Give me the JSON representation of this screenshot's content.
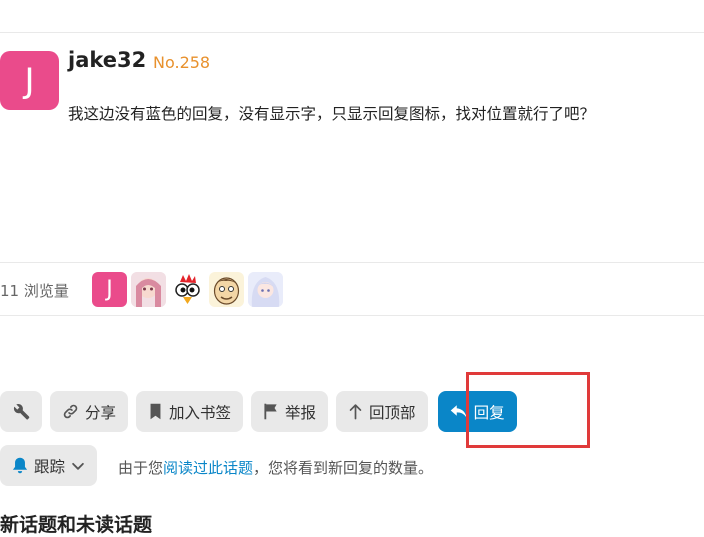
{
  "post": {
    "avatar_letter": "J",
    "username": "jake32",
    "post_number": "No.258",
    "body": "我这边没有蓝色的回复，没有显示字，只显示回复图标，找对位置就行了吧？"
  },
  "meta": {
    "views": "11 浏览量",
    "participant_letter": "J"
  },
  "actions": {
    "share": "分享",
    "bookmark": "加入书签",
    "report": "举报",
    "top": "回顶部",
    "reply": "回复"
  },
  "tracking": {
    "button": "跟踪",
    "text_before": "由于您",
    "link": "阅读过此话题",
    "text_after": "，您将看到新回复的数量。"
  },
  "footer_heading": "新话题和未读话题",
  "colors": {
    "accent": "#0a86c8",
    "avatar": "#ea4b8b",
    "post_number": "#e8912d",
    "highlight": "#e03a3a"
  }
}
